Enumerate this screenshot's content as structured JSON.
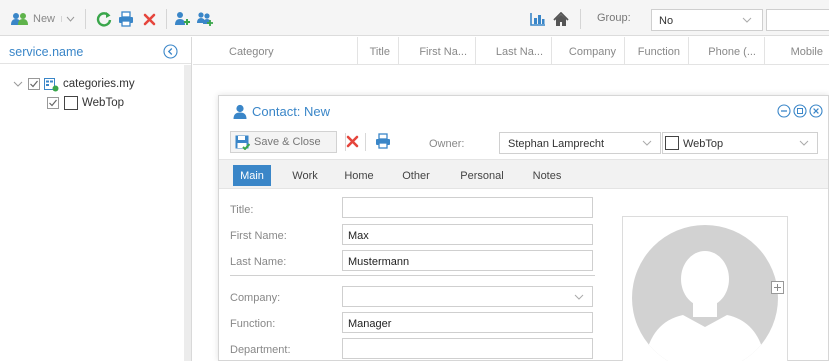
{
  "toolbar": {
    "new_label": "New",
    "group_label": "Group:",
    "group_value": "No",
    "icons": [
      "new-contact-icon",
      "dropdown-chevron-icon",
      "refresh-icon",
      "print-icon",
      "delete-icon",
      "add-contact-icon",
      "add-contacts-list-icon",
      "chart-icon",
      "home-icon"
    ]
  },
  "sidebar": {
    "title": "service.name",
    "tree": [
      {
        "label": "categories.my",
        "checked": true,
        "level": 0
      },
      {
        "label": "WebTop",
        "checked": true,
        "level": 1
      }
    ]
  },
  "grid": {
    "columns": [
      "Category",
      "Title",
      "First Na...",
      "Last Na...",
      "Company",
      "Function",
      "Phone (...",
      "Mobile"
    ]
  },
  "dialog": {
    "title": "Contact: New",
    "save_close_label": "Save & Close",
    "owner_label": "Owner:",
    "owner_value": "Stephan Lamprecht",
    "category_value": "WebTop",
    "tabs": [
      "Main",
      "Work",
      "Home",
      "Other",
      "Personal",
      "Notes"
    ],
    "active_tab": "Main",
    "fields": {
      "title": {
        "label": "Title:",
        "value": ""
      },
      "first_name": {
        "label": "First Name:",
        "value": "Max"
      },
      "last_name": {
        "label": "Last Name:",
        "value": "Mustermann"
      },
      "company": {
        "label": "Company:",
        "value": ""
      },
      "function": {
        "label": "Function:",
        "value": "Manager"
      },
      "department": {
        "label": "Department:",
        "value": ""
      }
    }
  },
  "colors": {
    "accent": "#3a86c8",
    "delete": "#e5453c",
    "refresh": "#3aa64b"
  }
}
